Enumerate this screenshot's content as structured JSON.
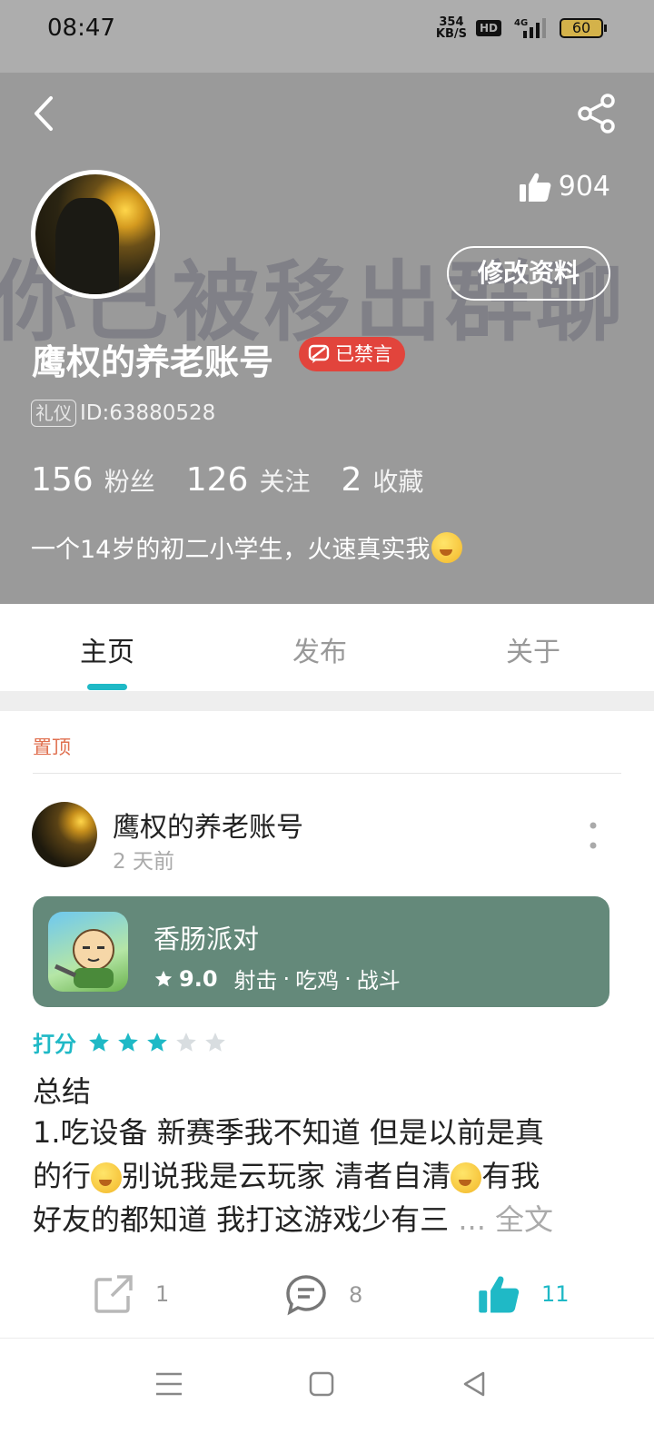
{
  "status_bar": {
    "time": "08:47",
    "net_speed_value": "354",
    "net_speed_unit": "KB/S",
    "hd_label": "HD",
    "network_label": "4G",
    "battery": "60"
  },
  "profile": {
    "watermark": "你已被移出群聊",
    "likes": "904",
    "edit_label": "修改资料",
    "username": "鹰权的养老账号",
    "muted_badge": "已禁言",
    "etiquette_tag": "礼仪",
    "id_text": "ID:63880528",
    "stats": [
      {
        "num": "156",
        "label": "粉丝"
      },
      {
        "num": "126",
        "label": "关注"
      },
      {
        "num": "2",
        "label": "收藏"
      }
    ],
    "bio": "一个14岁的初二小学生，火速真实我"
  },
  "tabs": [
    {
      "label": "主页",
      "active": true
    },
    {
      "label": "发布",
      "active": false
    },
    {
      "label": "关于",
      "active": false
    }
  ],
  "post": {
    "pinned_label": "置顶",
    "author": "鹰权的养老账号",
    "time": "2 天前",
    "game": {
      "name": "香肠派对",
      "score": "9.0",
      "tags": [
        "射击",
        "吃鸡",
        "战斗"
      ]
    },
    "rating_label": "打分",
    "rating": 3,
    "rating_max": 5,
    "title": "总结",
    "body_line1": "1.吃设备 新赛季我不知道 但是以前是真",
    "body_line2a": "的行",
    "body_line2b": "别说我是云玩家 清者自清",
    "body_line2c": "有我",
    "body_line3": "好友的都知道 我打这游戏少有三",
    "ellipsis": "...",
    "fulltext_label": "全文",
    "share_count": "1",
    "comment_count": "8",
    "like_count": "11"
  },
  "colors": {
    "accent": "#1fb9c6",
    "muted_badge": "#e2443c",
    "game_card": "#64897a",
    "header_bg": "#9a9a9a"
  }
}
